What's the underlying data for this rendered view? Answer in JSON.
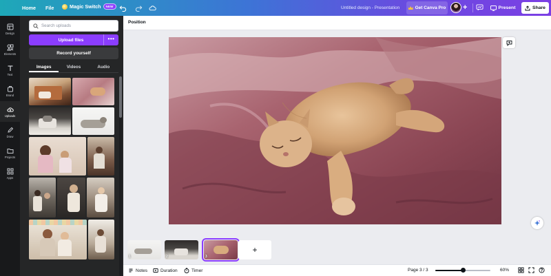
{
  "topbar": {
    "home": "Home",
    "file": "File",
    "magic_switch": "Magic Switch",
    "magic_badge": "NEW",
    "title": "Untitled design - Presentation",
    "get_pro": "Get Canva Pro",
    "present": "Present",
    "share": "Share"
  },
  "rail": [
    {
      "label": "Design",
      "icon": "design-icon"
    },
    {
      "label": "Elements",
      "icon": "elements-icon"
    },
    {
      "label": "Text",
      "icon": "text-icon"
    },
    {
      "label": "Brand",
      "icon": "brand-icon"
    },
    {
      "label": "Uploads",
      "icon": "cloud-upload-icon"
    },
    {
      "label": "Draw",
      "icon": "draw-icon"
    },
    {
      "label": "Projects",
      "icon": "folder-icon"
    },
    {
      "label": "Apps",
      "icon": "apps-icon"
    }
  ],
  "panel": {
    "search_placeholder": "Search uploads",
    "upload_files": "Upload files",
    "upload_more": "•••",
    "record_yourself": "Record yourself",
    "tabs": [
      "Images",
      "Videos",
      "Audio"
    ]
  },
  "toolbar": {
    "position": "Position"
  },
  "pages": {
    "add": "+",
    "collapse_glyph": "⌄",
    "numbers": [
      "1",
      "2",
      "3"
    ]
  },
  "footer": {
    "notes": "Notes",
    "duration": "Duration",
    "timer": "Timer",
    "page_indicator": "Page 3 / 3",
    "zoom": "60%",
    "zoom_fraction": 0.5
  },
  "colors": {
    "accent": "#8b3dff",
    "panel_bg": "#252627",
    "rail_bg": "#18191b"
  }
}
